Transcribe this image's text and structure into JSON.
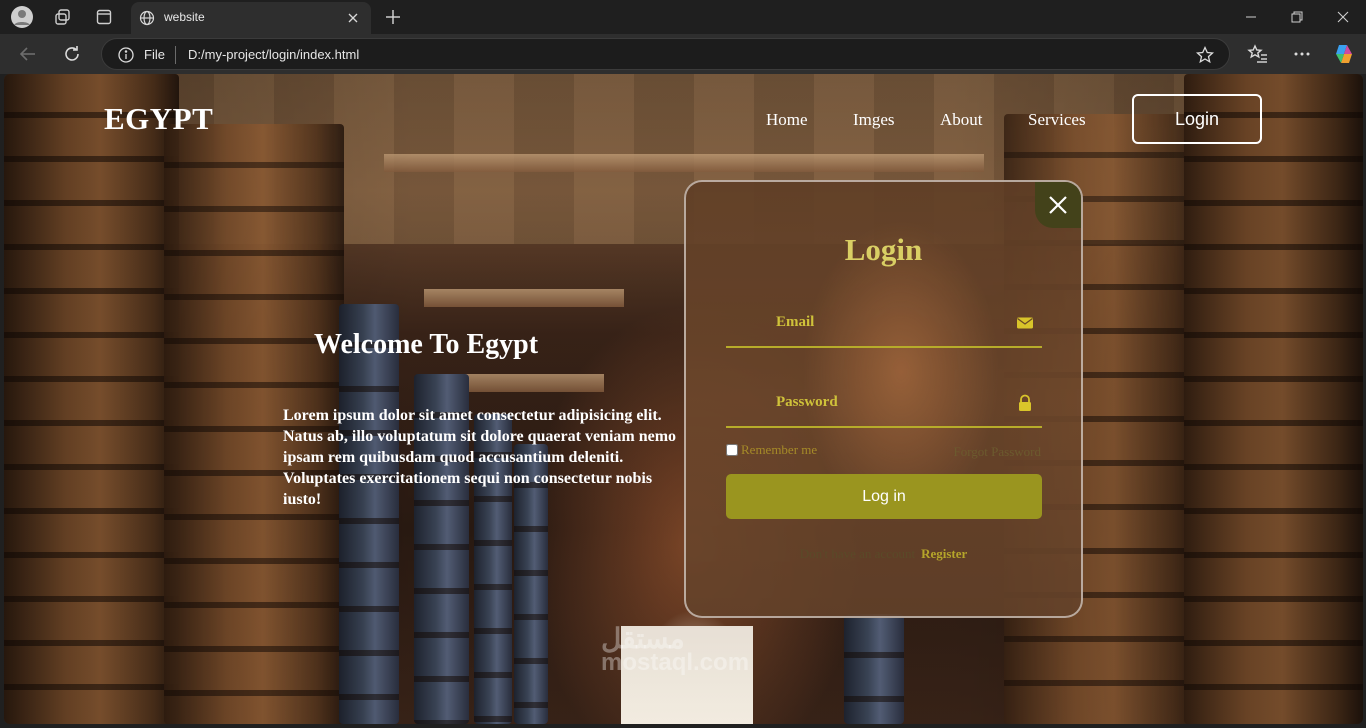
{
  "browser": {
    "tab_title": "website",
    "address_scheme": "File",
    "address_url": "D:/my-project/login/index.html"
  },
  "site": {
    "logo": "EGYPT",
    "nav": [
      "Home",
      "Imges",
      "About",
      "Services"
    ],
    "nav_login": "Login"
  },
  "hero": {
    "title": "Welcome To Egypt",
    "text": "Lorem ipsum dolor sit amet consectetur adipisicing elit. Natus ab, illo voluptatum sit dolore quaerat veniam nemo ipsam rem quibusdam quod accusantium deleniti. Voluptates exercitationem sequi non consectetur nobis iusto!"
  },
  "login_form": {
    "title": "Login",
    "email_label": "Email",
    "password_label": "Password",
    "remember_label": "Remember me",
    "forgot_label": "Forgot Password",
    "submit_label": "Log in",
    "no_account_text": "Don't have an account",
    "register_label": "Register"
  },
  "watermark": {
    "arabic": "مستقل",
    "latin": "mostaql.com"
  },
  "colors": {
    "accent": "#9a951f",
    "title": "#d9cf64"
  }
}
